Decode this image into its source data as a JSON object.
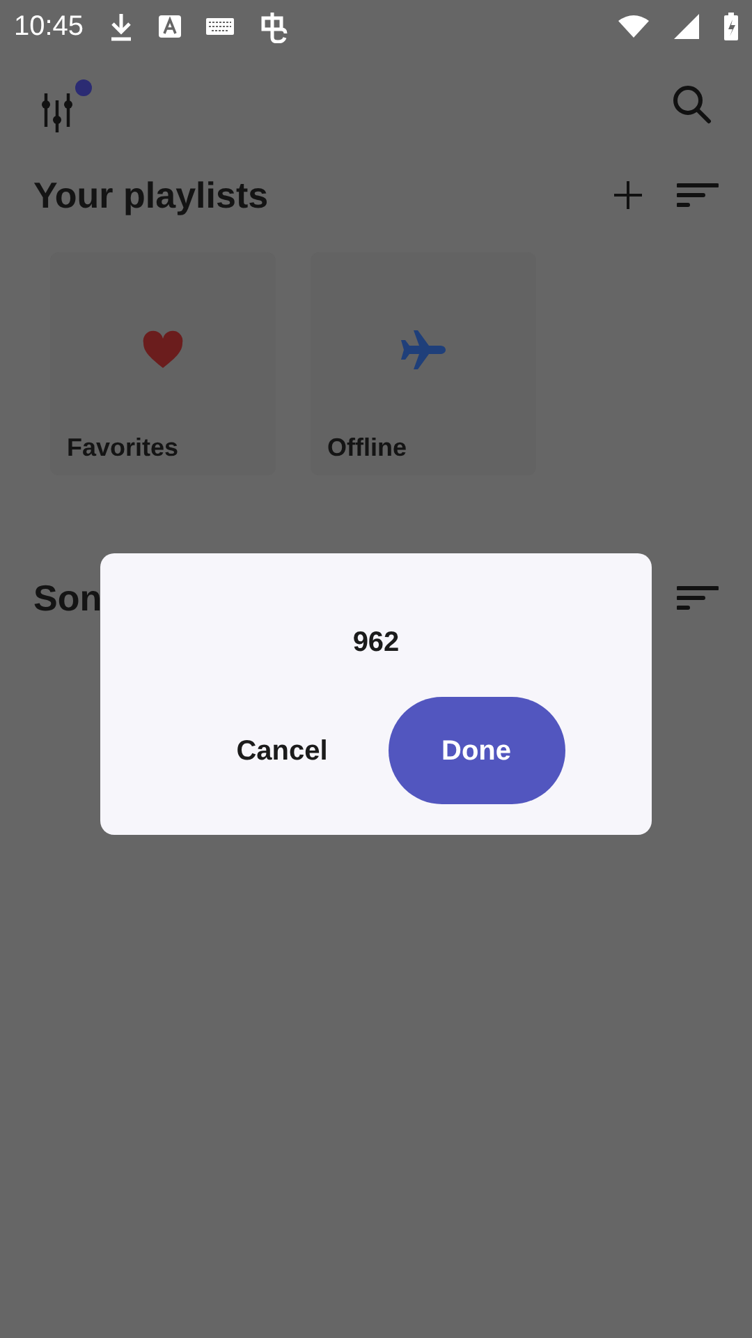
{
  "status_bar": {
    "time": "10:45"
  },
  "playlists": {
    "title": "Your playlists",
    "items": [
      {
        "kind": "favorites",
        "label": "Favorites"
      },
      {
        "kind": "offline",
        "label": "Offline"
      }
    ]
  },
  "songs": {
    "title": "Son"
  },
  "dialog": {
    "value": "962",
    "buttons": [
      {
        "label": "Cancel",
        "kind": "text"
      },
      {
        "label": "Done",
        "kind": "filled"
      }
    ]
  }
}
